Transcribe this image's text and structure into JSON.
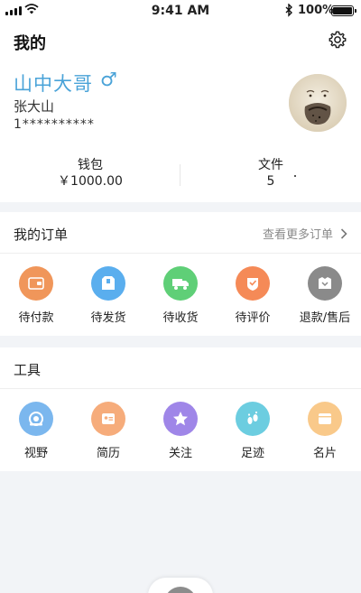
{
  "status": {
    "time": "9:41 AM",
    "battery": "100%"
  },
  "header": {
    "title": "我的",
    "settings_icon": "gear-icon"
  },
  "user": {
    "nickname": "山中大哥",
    "gender_symbol": "♂",
    "real_name": "张大山",
    "phone": "1**********"
  },
  "stats": [
    {
      "label": "钱包",
      "value": "￥1000.00"
    },
    {
      "label": "文件",
      "value": "5"
    }
  ],
  "orders": {
    "title": "我的订单",
    "more": "查看更多订单",
    "items": [
      {
        "label": "待付款",
        "icon": "wallet-icon",
        "color": "#f0965a"
      },
      {
        "label": "待发货",
        "icon": "package-icon",
        "color": "#5aaeee"
      },
      {
        "label": "待收货",
        "icon": "truck-icon",
        "color": "#5fcf77"
      },
      {
        "label": "待评价",
        "icon": "review-icon",
        "color": "#f58a57"
      },
      {
        "label": "退款/售后",
        "icon": "refund-icon",
        "color": "#8a8a8a"
      }
    ]
  },
  "tools": {
    "title": "工具",
    "items": [
      {
        "label": "视野",
        "icon": "eye-icon",
        "color": "#7bb7ee"
      },
      {
        "label": "简历",
        "icon": "resume-icon",
        "color": "#f6ac7b"
      },
      {
        "label": "关注",
        "icon": "star-icon",
        "color": "#9f86e8"
      },
      {
        "label": "足迹",
        "icon": "footprint-icon",
        "color": "#6ccde0"
      },
      {
        "label": "名片",
        "icon": "card-icon",
        "color": "#f9c98a"
      }
    ]
  }
}
